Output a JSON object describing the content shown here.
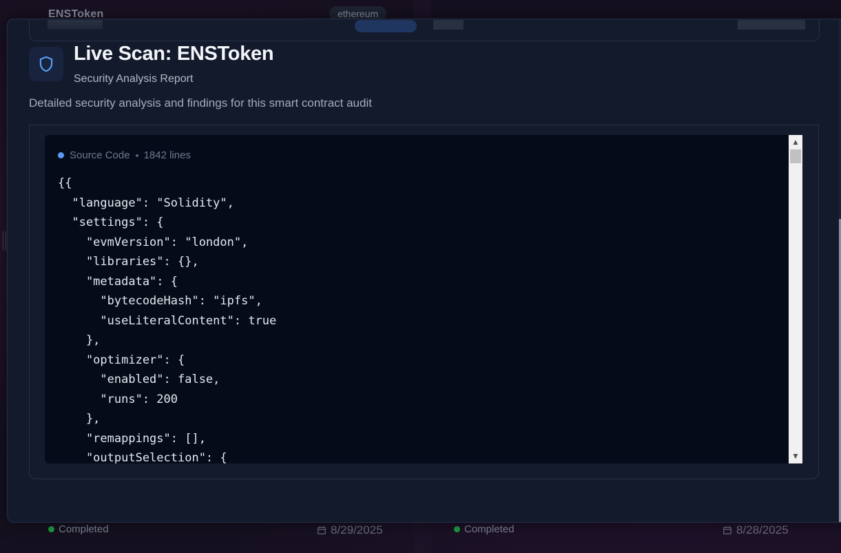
{
  "background": {
    "card_left": {
      "name": "ENSToken",
      "chain": "ethereum",
      "status": "Completed",
      "date": "8/29/2025"
    },
    "card_right": {
      "status": "Completed",
      "date": "8/28/2025"
    }
  },
  "modal": {
    "title": "Live Scan: ENSToken",
    "subtitle": "Security Analysis Report",
    "description": "Detailed security analysis and findings for this smart contract audit",
    "icon": "shield-icon",
    "code": {
      "label": "Source Code",
      "line_count": "1842 lines",
      "lines": [
        "{{",
        "  \"language\": \"Solidity\",",
        "  \"settings\": {",
        "    \"evmVersion\": \"london\",",
        "    \"libraries\": {},",
        "    \"metadata\": {",
        "      \"bytecodeHash\": \"ipfs\",",
        "      \"useLiteralContent\": true",
        "    },",
        "    \"optimizer\": {",
        "      \"enabled\": false,",
        "      \"runs\": 200",
        "    },",
        "    \"remappings\": [],",
        "    \"outputSelection\": {"
      ]
    }
  },
  "colors": {
    "accent_blue": "#5a9cf5",
    "status_green": "#1f9d45",
    "modal_bg": "#131a2b",
    "code_bg": "#060b1a"
  }
}
